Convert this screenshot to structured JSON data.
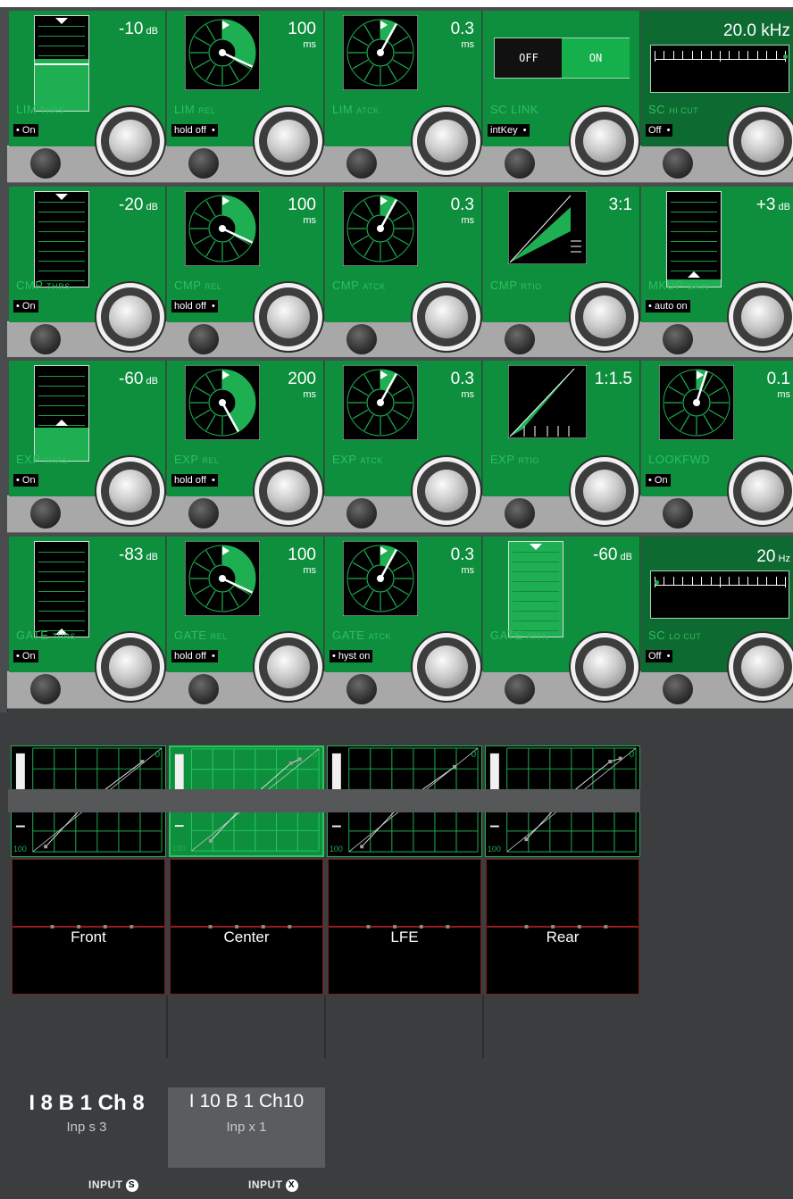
{
  "rows": [
    {
      "cells": [
        {
          "kind": "meter",
          "value": "-10",
          "unit": "dB",
          "label": "LIM",
          "sub": "THRS",
          "tag": "• On",
          "level": 0.55,
          "marker": "top"
        },
        {
          "kind": "dial",
          "value": "100",
          "unit": "ms",
          "label": "LIM",
          "sub": "REL",
          "tag": "hold off  •",
          "arc": 0.32
        },
        {
          "kind": "dial",
          "value": "0.3",
          "unit": "ms",
          "label": "LIM",
          "sub": "ATCK",
          "tag": "",
          "arc": 0.08
        },
        {
          "kind": "onoff",
          "label": "SC LINK",
          "sub": "",
          "tag": "intKey  •",
          "off": "OFF",
          "on": "ON"
        },
        {
          "kind": "slider",
          "value": "20.0 kHz",
          "label": "SC",
          "sub": "HI CUT",
          "tag": "Off  •",
          "pos": 1.0,
          "dark": true
        }
      ]
    },
    {
      "cells": [
        {
          "kind": "meter",
          "value": "-20",
          "unit": "dB",
          "label": "CMP",
          "sub": "THRS",
          "tag": "• On",
          "level": 0.0,
          "marker": "top"
        },
        {
          "kind": "dial",
          "value": "100",
          "unit": "ms",
          "label": "CMP",
          "sub": "REL",
          "tag": "hold off  •",
          "arc": 0.32
        },
        {
          "kind": "dial",
          "value": "0.3",
          "unit": "ms",
          "label": "CMP",
          "sub": "ATCK",
          "tag": "",
          "arc": 0.08
        },
        {
          "kind": "ratio",
          "value": "3:1",
          "label": "CMP",
          "sub": "RTIO",
          "tag": "",
          "mode": "comp"
        },
        {
          "kind": "meter",
          "value": "+3",
          "unit": "dB",
          "label": "MKUP",
          "sub": "GAIN",
          "tag": "• auto on",
          "level": 0.08,
          "marker": "bottom"
        }
      ]
    },
    {
      "cells": [
        {
          "kind": "meter",
          "value": "-60",
          "unit": "dB",
          "label": "EXP",
          "sub": "THRS",
          "tag": "• On",
          "level": 0.35,
          "marker": "bottom"
        },
        {
          "kind": "dial",
          "value": "200",
          "unit": "ms",
          "label": "EXP",
          "sub": "REL",
          "tag": "hold off  •",
          "arc": 0.42
        },
        {
          "kind": "dial",
          "value": "0.3",
          "unit": "ms",
          "label": "EXP",
          "sub": "ATCK",
          "tag": "",
          "arc": 0.08
        },
        {
          "kind": "ratio",
          "value": "1:1.5",
          "label": "EXP",
          "sub": "RTIO",
          "tag": "",
          "mode": "exp"
        },
        {
          "kind": "dial",
          "value": "0.1",
          "unit": "ms",
          "label": "LOOKFWD",
          "sub": "",
          "tag": "• On",
          "arc": 0.05
        }
      ]
    },
    {
      "cells": [
        {
          "kind": "meter",
          "value": "-83",
          "unit": "dB",
          "label": "GATE",
          "sub": "THRS",
          "tag": "• On",
          "level": 0.0,
          "marker": "bottom"
        },
        {
          "kind": "dial",
          "value": "100",
          "unit": "ms",
          "label": "GATE",
          "sub": "REL",
          "tag": "hold off  •",
          "arc": 0.32
        },
        {
          "kind": "dial",
          "value": "0.3",
          "unit": "ms",
          "label": "GATE",
          "sub": "ATCK",
          "tag": "• hyst on",
          "arc": 0.08
        },
        {
          "kind": "meter",
          "value": "-60",
          "unit": "dB",
          "label": "GATE",
          "sub": "ATTN",
          "tag": "",
          "level": 1.0,
          "marker": "top",
          "green": true
        },
        {
          "kind": "slider",
          "value": "20",
          "unit": "Hz",
          "label": "SC",
          "sub": "LO CUT",
          "tag": "Off  •",
          "pos": 0.0,
          "dark": true
        }
      ]
    }
  ],
  "channels": [
    {
      "name": "Front",
      "active": false,
      "pts": [
        [
          0.1,
          0.95
        ],
        [
          0.4,
          0.55
        ],
        [
          0.85,
          0.13
        ]
      ]
    },
    {
      "name": "Center",
      "active": true,
      "pts": [
        [
          0.15,
          0.9
        ],
        [
          0.45,
          0.5
        ],
        [
          0.78,
          0.14
        ],
        [
          0.85,
          0.1
        ]
      ]
    },
    {
      "name": "LFE",
      "active": false,
      "pts": [
        [
          0.1,
          0.95
        ],
        [
          0.4,
          0.55
        ],
        [
          0.82,
          0.18
        ]
      ]
    },
    {
      "name": "Rear",
      "active": false,
      "pts": [
        [
          0.15,
          0.88
        ],
        [
          0.45,
          0.48
        ],
        [
          0.8,
          0.13
        ],
        [
          0.88,
          0.1
        ]
      ]
    }
  ],
  "graph_corner_top": "0",
  "graph_corner_bottom": "100",
  "tiles": [
    {
      "name": "I 8 B 1 Ch 8",
      "sub": "Inp s  3",
      "input": "INPUT",
      "icon": "S",
      "active": false
    },
    {
      "name": "I 10 B 1 Ch10",
      "sub": "Inp x  1",
      "input": "INPUT",
      "icon": "X",
      "active": true
    }
  ],
  "colors": {
    "accent": "#0e8f3d",
    "accent_dark": "#0d6b31",
    "label": "#2cc15f",
    "eq_line": "#c62828"
  }
}
